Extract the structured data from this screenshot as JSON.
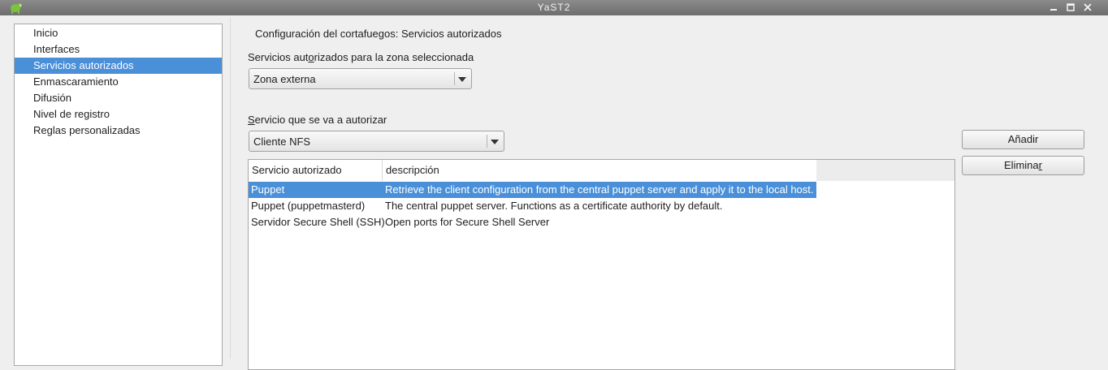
{
  "window": {
    "title": "YaST2",
    "icons": {
      "app": "yast-chameleon-icon",
      "minimize": "minimize-icon",
      "maximize": "maximize-icon",
      "close": "close-icon"
    }
  },
  "sidebar": {
    "items": [
      {
        "label": "Inicio",
        "selected": false
      },
      {
        "label": "Interfaces",
        "selected": false
      },
      {
        "label": "Servicios autorizados",
        "selected": true
      },
      {
        "label": "Enmascaramiento",
        "selected": false
      },
      {
        "label": "Difusión",
        "selected": false
      },
      {
        "label": "Nivel de registro",
        "selected": false
      },
      {
        "label": "Reglas personalizadas",
        "selected": false
      }
    ]
  },
  "main": {
    "heading": "Configuración del cortafuegos: Servicios autorizados",
    "zone_label": {
      "pre": "Servicios aut",
      "mnemonic": "o",
      "post": "rizados para la zona seleccionada"
    },
    "zone_select": {
      "value": "Zona externa"
    },
    "service_label": {
      "pre": "",
      "mnemonic": "S",
      "post": "ervicio que se va a autorizar"
    },
    "service_select": {
      "value": "Cliente NFS"
    },
    "add_button": "Añadir",
    "remove_button": {
      "pre": "Elimina",
      "mnemonic": "r",
      "post": ""
    },
    "table": {
      "columns": [
        "Servicio autorizado",
        "descripción"
      ],
      "rows": [
        {
          "service": "Puppet",
          "description": "Retrieve the client configuration from the central puppet server and apply it to the local host.",
          "selected": true
        },
        {
          "service": "Puppet (puppetmasterd)",
          "description": "The central puppet server. Functions as a certificate authority by default.",
          "selected": false
        },
        {
          "service": "Servidor Secure Shell (SSH)",
          "description": "Open ports for Secure Shell Server",
          "selected": false
        }
      ]
    }
  },
  "colors": {
    "selection": "#4a90d9",
    "titlebar": "#7a7a7a",
    "background": "#efefef"
  }
}
